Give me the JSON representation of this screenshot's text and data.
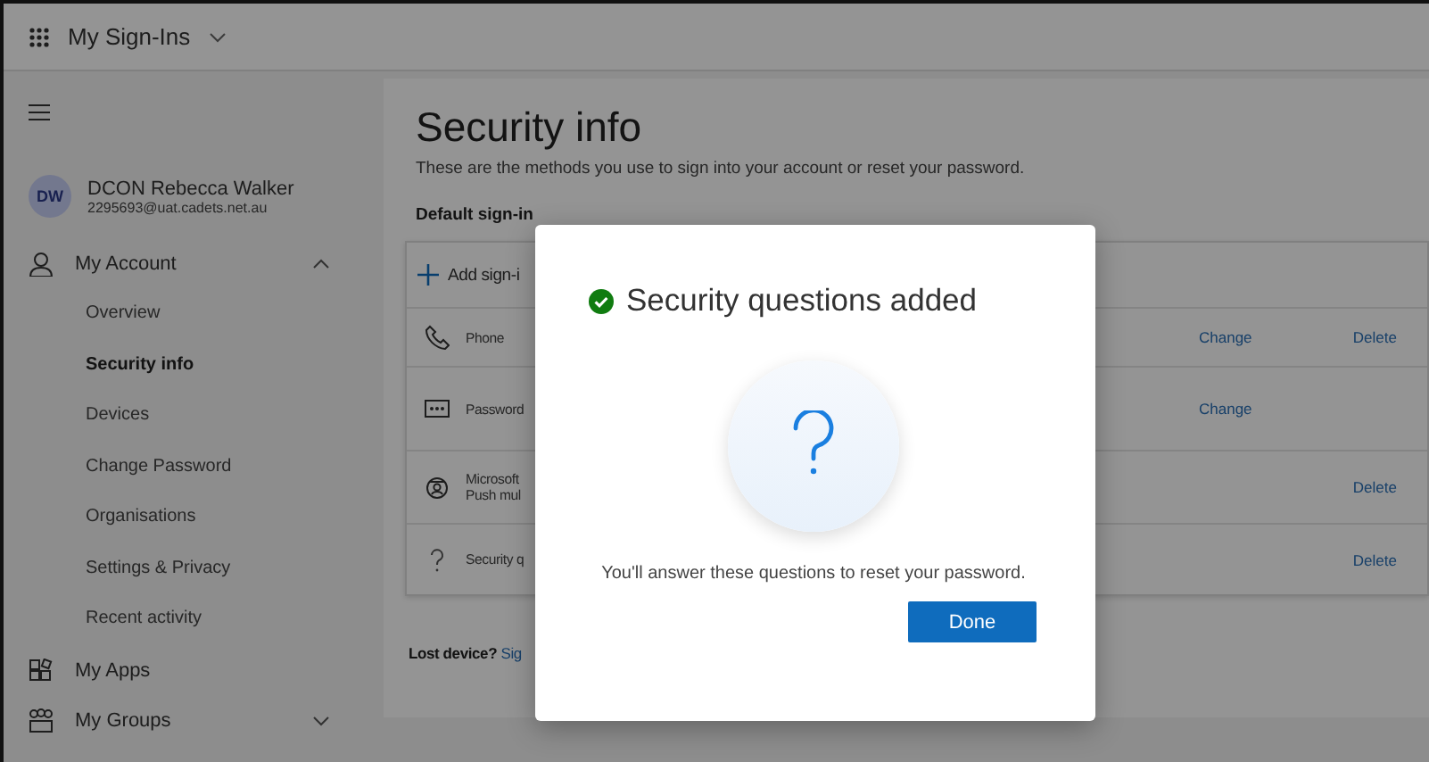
{
  "header": {
    "app_title": "My Sign-Ins"
  },
  "user": {
    "initials": "DW",
    "name": "DCON Rebecca Walker",
    "email": "2295693@uat.cadets.net.au"
  },
  "sidebar": {
    "items": [
      {
        "label": "My Account",
        "kind": "group",
        "expanded": true,
        "children": [
          {
            "label": "Overview",
            "selected": false
          },
          {
            "label": "Security info",
            "selected": true
          },
          {
            "label": "Devices",
            "selected": false
          },
          {
            "label": "Change Password",
            "selected": false
          },
          {
            "label": "Organisations",
            "selected": false
          },
          {
            "label": "Settings & Privacy",
            "selected": false
          },
          {
            "label": "Recent activity",
            "selected": false
          }
        ]
      },
      {
        "label": "My Apps",
        "kind": "link"
      },
      {
        "label": "My Groups",
        "kind": "group",
        "expanded": false
      }
    ]
  },
  "main": {
    "title": "Security info",
    "description": "These are the methods you use to sign into your account or reset your password.",
    "default_label": "Default sign-in",
    "add_label": "Add sign-i",
    "methods": [
      {
        "kind": "phone",
        "name": "Phone",
        "actions": [
          "Change",
          "Delete"
        ]
      },
      {
        "kind": "password",
        "name": "Password",
        "actions": [
          "Change"
        ]
      },
      {
        "kind": "authenticator",
        "name": "Microsoft",
        "detail": "Push mul",
        "actions": [
          "Delete"
        ]
      },
      {
        "kind": "question",
        "name": "Security q",
        "actions": [
          "Delete"
        ]
      }
    ],
    "lost_device": "Lost device?",
    "lost_link": "Sig"
  },
  "dialog": {
    "title": "Security questions added",
    "message": "You'll answer these questions to reset your password.",
    "button": "Done"
  }
}
